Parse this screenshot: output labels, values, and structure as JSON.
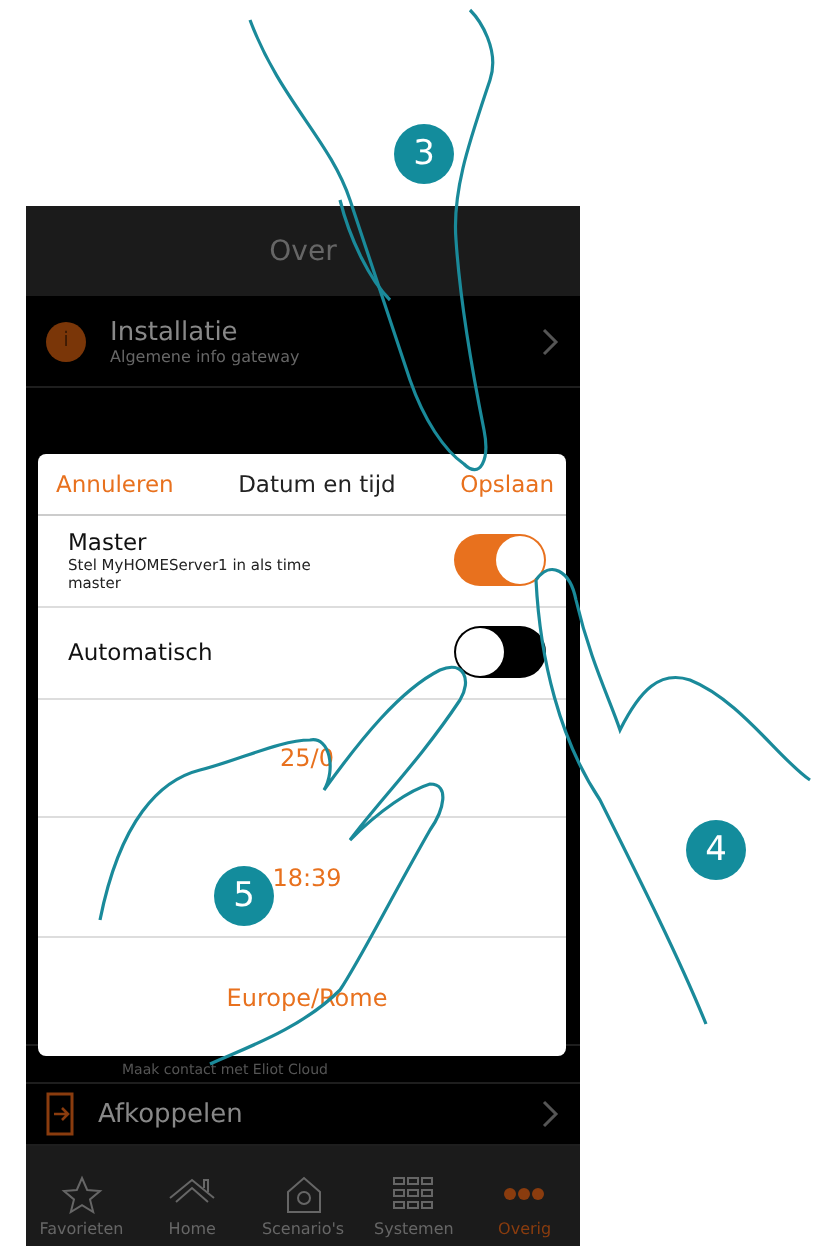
{
  "header": {
    "title": "Over"
  },
  "menu": [
    {
      "kind": "info",
      "icon_text": "i",
      "title": "Installatie",
      "subtitle": "Algemene info gateway"
    },
    {
      "kind": "cloud",
      "subtitle": "Maak contact met Eliot Cloud"
    },
    {
      "kind": "exit",
      "title": "Afkoppelen"
    }
  ],
  "dialog": {
    "cancel": "Annuleren",
    "title": "Datum en tijd",
    "save": "Opslaan",
    "rows": [
      {
        "kind": "toggle",
        "label": "Master",
        "description": "Stel MyHOMEServer1 in als time master",
        "on": true
      },
      {
        "kind": "toggle",
        "label": "Automatisch",
        "on": false
      },
      {
        "kind": "value",
        "value": "25/0"
      },
      {
        "kind": "value",
        "value": "18:39"
      },
      {
        "kind": "value",
        "value": "Europe/Rome"
      }
    ]
  },
  "tabs": [
    {
      "label": "Favorieten",
      "selected": false
    },
    {
      "label": "Home",
      "selected": false
    },
    {
      "label": "Scenario's",
      "selected": false
    },
    {
      "label": "Systemen",
      "selected": false
    },
    {
      "label": "Overig",
      "selected": true
    }
  ],
  "steps": [
    "3",
    "4",
    "5"
  ]
}
